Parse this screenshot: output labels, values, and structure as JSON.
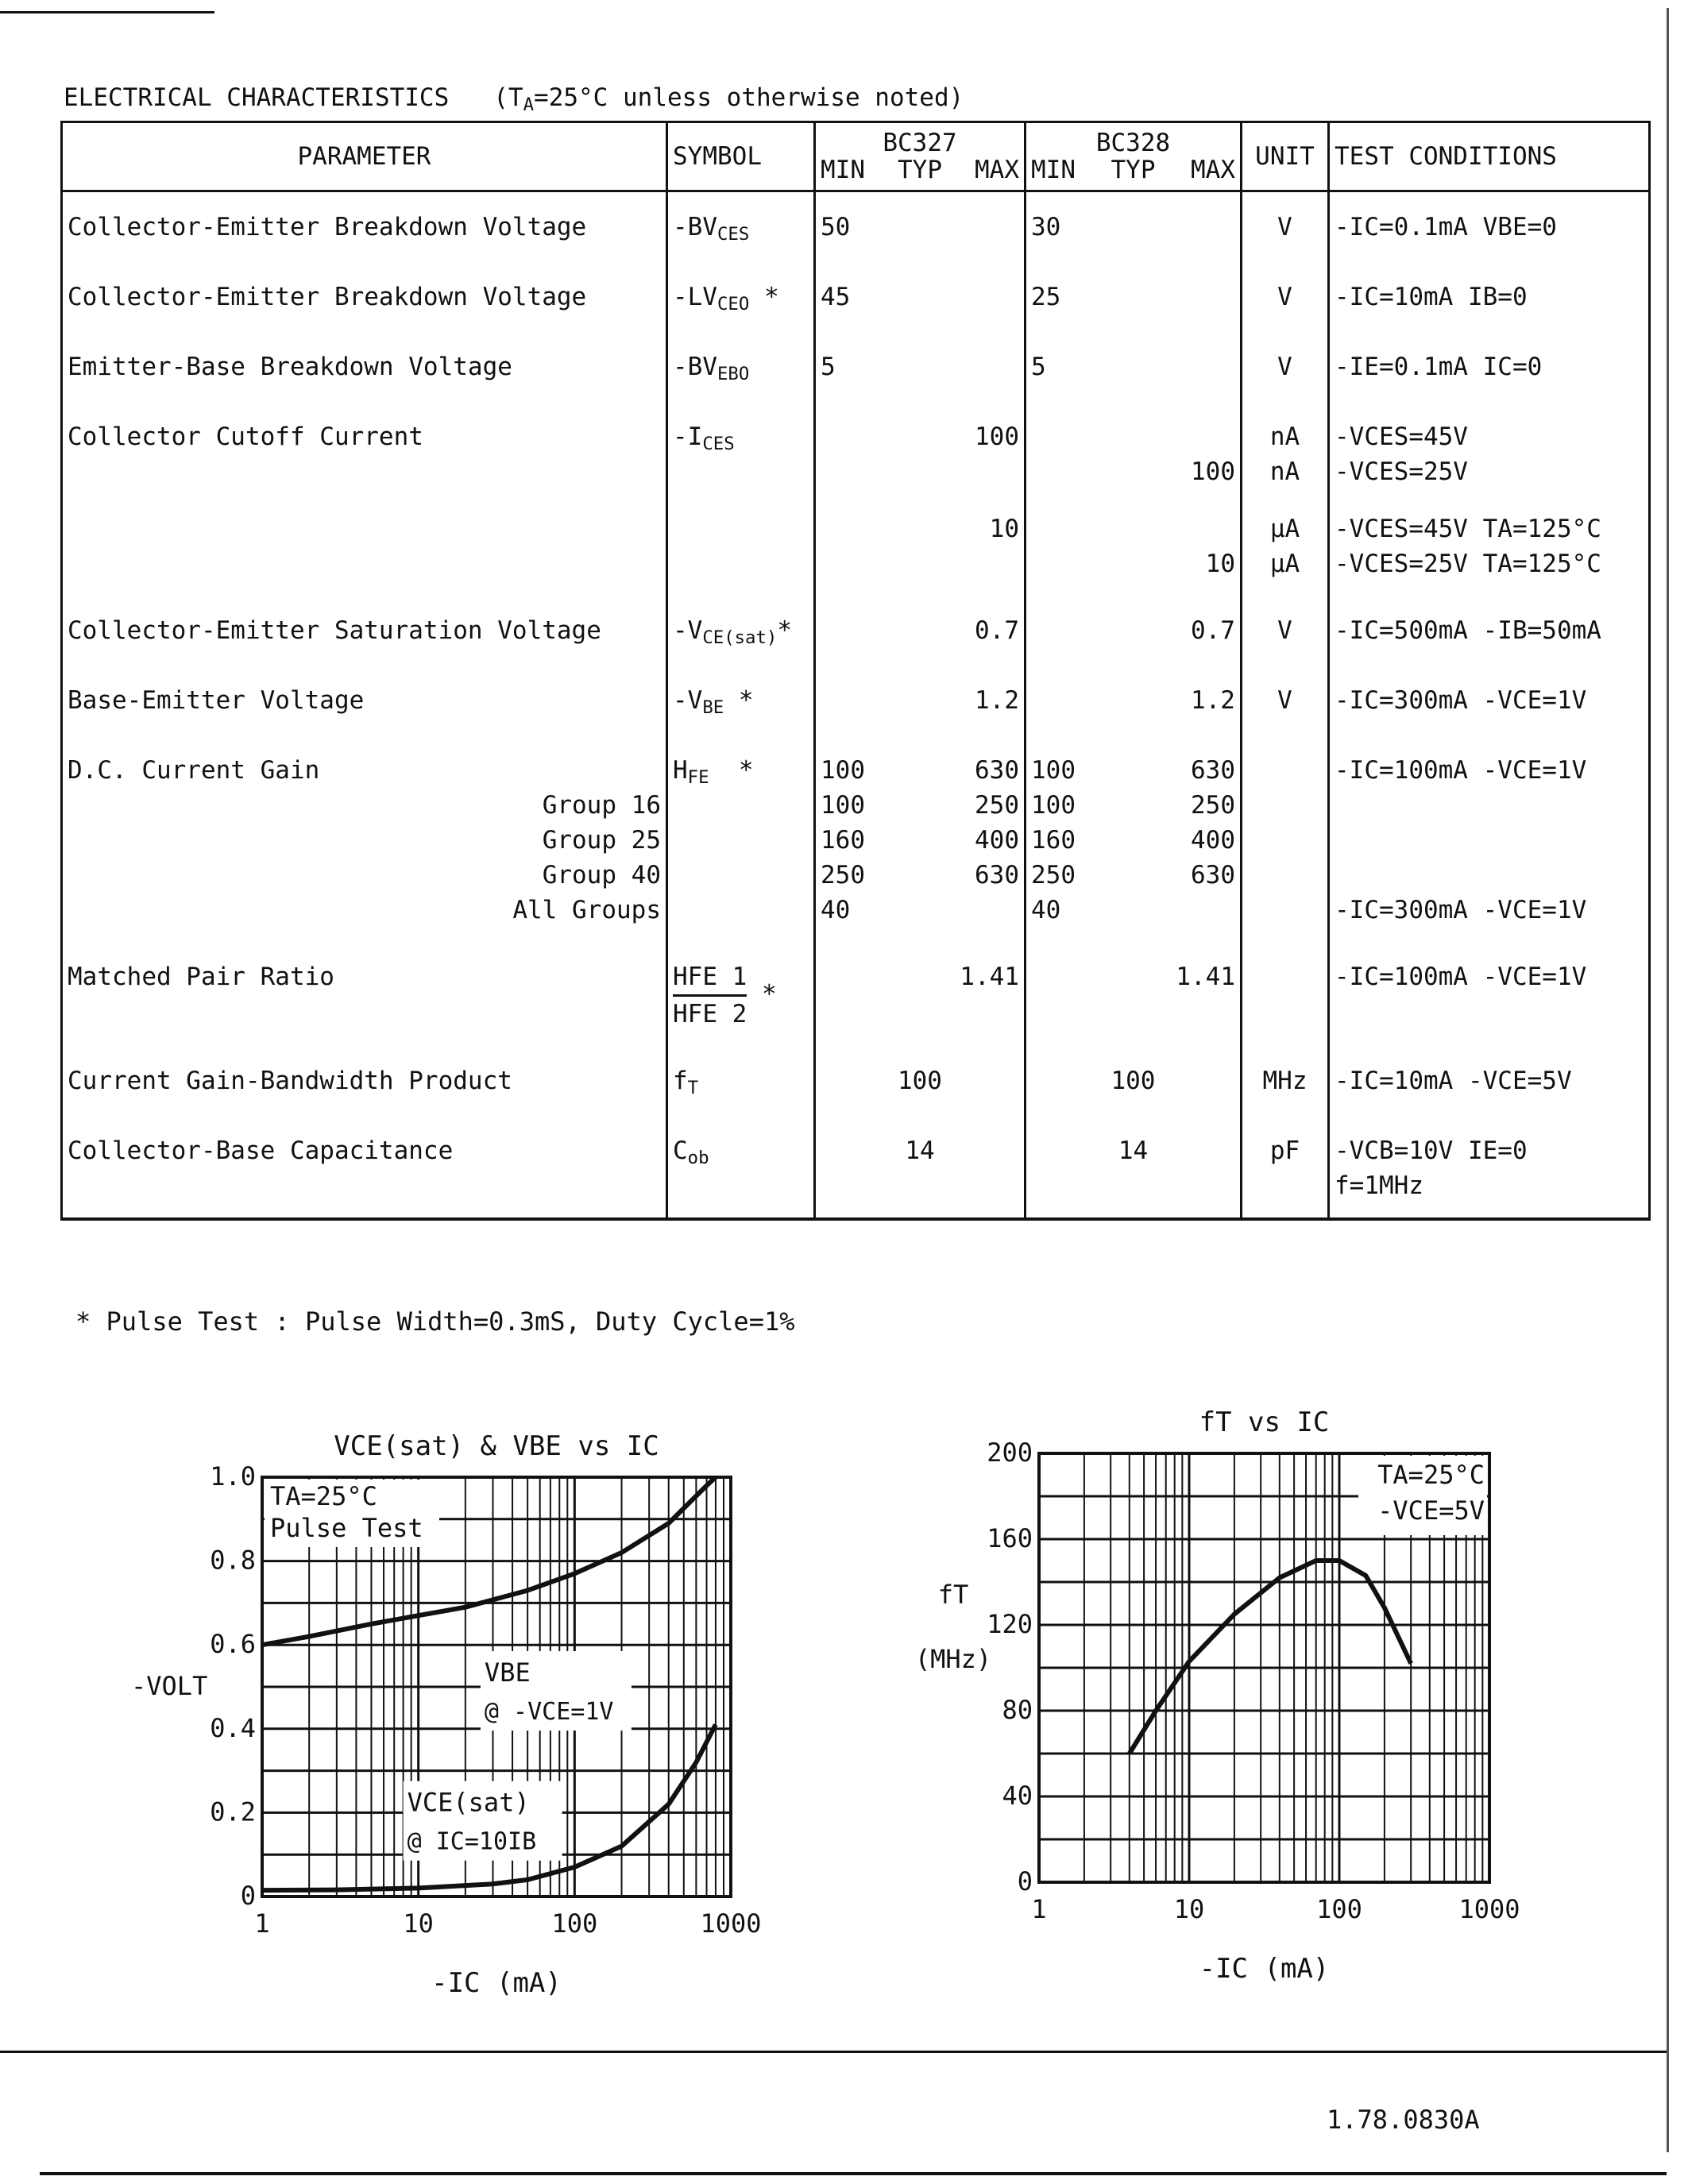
{
  "header": {
    "title": "ELECTRICAL CHARACTERISTICS",
    "condition_prefix": "(T",
    "condition_sub": "A",
    "condition_suffix": "=25°C  unless otherwise noted)"
  },
  "table": {
    "columns": {
      "parameter": "PARAMETER",
      "symbol": "SYMBOL",
      "bc327": "BC327",
      "bc328": "BC328",
      "min_typ_max": [
        "MIN",
        "TYP",
        "MAX"
      ],
      "unit": "UNIT",
      "test_conditions": "TEST CONDITIONS"
    },
    "rows": [
      {
        "parameter": "Collector-Emitter Breakdown Voltage",
        "symbol": "-BV",
        "symbol_sub": "CES",
        "symbol_suffix": "",
        "bc327": {
          "min": "50",
          "typ": "",
          "max": ""
        },
        "bc328": {
          "min": "30",
          "typ": "",
          "max": ""
        },
        "unit": "V",
        "conditions": "-IC=0.1mA  VBE=0"
      },
      {
        "parameter": "Collector-Emitter Breakdown Voltage",
        "symbol": "-LV",
        "symbol_sub": "CEO",
        "symbol_suffix": " *",
        "bc327": {
          "min": "45",
          "typ": "",
          "max": ""
        },
        "bc328": {
          "min": "25",
          "typ": "",
          "max": ""
        },
        "unit": "V",
        "conditions": "-IC=10mA  IB=0"
      },
      {
        "parameter": "Emitter-Base Breakdown Voltage",
        "symbol": "-BV",
        "symbol_sub": "EBO",
        "symbol_suffix": "",
        "bc327": {
          "min": "5",
          "typ": "",
          "max": ""
        },
        "bc328": {
          "min": "5",
          "typ": "",
          "max": ""
        },
        "unit": "V",
        "conditions": "-IE=0.1mA  IC=0"
      },
      {
        "parameter": "Collector Cutoff Current",
        "symbol": "-I",
        "symbol_sub": "CES",
        "symbol_suffix": "",
        "lines": [
          {
            "bc327_max": "100",
            "bc328_max": "",
            "unit": "nA",
            "conditions": "-VCES=45V"
          },
          {
            "bc327_max": "",
            "bc328_max": "100",
            "unit": "nA",
            "conditions": "-VCES=25V"
          },
          {
            "bc327_max": "10",
            "bc328_max": "",
            "unit": "µA",
            "conditions": "-VCES=45V  TA=125°C"
          },
          {
            "bc327_max": "",
            "bc328_max": "10",
            "unit": "µA",
            "conditions": "-VCES=25V  TA=125°C"
          }
        ]
      },
      {
        "parameter": "Collector-Emitter Saturation Voltage",
        "symbol": "-V",
        "symbol_sub": "CE(sat)",
        "symbol_suffix": "*",
        "bc327": {
          "min": "",
          "typ": "",
          "max": "0.7"
        },
        "bc328": {
          "min": "",
          "typ": "",
          "max": "0.7"
        },
        "unit": "V",
        "conditions": "-IC=500mA  -IB=50mA"
      },
      {
        "parameter": "Base-Emitter Voltage",
        "symbol": "-V",
        "symbol_sub": "BE",
        "symbol_suffix": " *",
        "bc327": {
          "min": "",
          "typ": "",
          "max": "1.2"
        },
        "bc328": {
          "min": "",
          "typ": "",
          "max": "1.2"
        },
        "unit": "V",
        "conditions": "-IC=300mA  -VCE=1V"
      },
      {
        "parameter": "D.C. Current Gain",
        "symbol": "H",
        "symbol_sub": "FE",
        "symbol_suffix": "  *",
        "groups": [
          {
            "label": "",
            "bc327_min": "100",
            "bc327_max": "630",
            "bc328_min": "100",
            "bc328_max": "630",
            "conditions": "-IC=100mA  -VCE=1V"
          },
          {
            "label": "Group 16",
            "bc327_min": "100",
            "bc327_max": "250",
            "bc328_min": "100",
            "bc328_max": "250",
            "conditions": ""
          },
          {
            "label": "Group 25",
            "bc327_min": "160",
            "bc327_max": "400",
            "bc328_min": "160",
            "bc328_max": "400",
            "conditions": ""
          },
          {
            "label": "Group 40",
            "bc327_min": "250",
            "bc327_max": "630",
            "bc328_min": "250",
            "bc328_max": "630",
            "conditions": ""
          },
          {
            "label": "All Groups",
            "bc327_min": "40",
            "bc327_max": "",
            "bc328_min": "40",
            "bc328_max": "",
            "conditions": "-IC=300mA  -VCE=1V"
          }
        ]
      },
      {
        "parameter": "Matched Pair Ratio",
        "parameter_prefix": "HFE",
        "symbol_num": "HFE 1",
        "symbol_den": "HFE 2",
        "symbol_suffix": "*",
        "bc327": {
          "min": "",
          "typ": "",
          "max": "1.41"
        },
        "bc328": {
          "min": "",
          "typ": "",
          "max": "1.41"
        },
        "unit": "",
        "conditions": "-IC=100mA  -VCE=1V"
      },
      {
        "parameter": "Current Gain-Bandwidth Product",
        "symbol": "f",
        "symbol_sub": "T",
        "symbol_suffix": "",
        "bc327": {
          "min": "",
          "typ": "100",
          "max": ""
        },
        "bc328": {
          "min": "",
          "typ": "100",
          "max": ""
        },
        "unit": "MHz",
        "conditions": "-IC=10mA  -VCE=5V"
      },
      {
        "parameter": "Collector-Base Capacitance",
        "symbol": "C",
        "symbol_sub": "ob",
        "symbol_suffix": "",
        "bc327": {
          "min": "",
          "typ": "14",
          "max": ""
        },
        "bc328": {
          "min": "",
          "typ": "14",
          "max": ""
        },
        "unit": "pF",
        "conditions": "-VCB=10V   IE=0",
        "conditions2": "f=1MHz"
      }
    ]
  },
  "footnote": "* Pulse Test : Pulse Width=0.3mS, Duty Cycle=1%",
  "document_id": "1.78.0830A",
  "chart_data": [
    {
      "type": "line",
      "title": "VCE(sat) & VBE  vs  IC",
      "xlabel": "-IC (mA)",
      "ylabel": "-VOLT",
      "xscale": "log",
      "xlim": [
        1,
        1000
      ],
      "ylim": [
        0,
        1.0
      ],
      "xticks": [
        "1",
        "10",
        "100",
        "1000"
      ],
      "yticks": [
        "0",
        "0.2",
        "0.4",
        "0.6",
        "0.8",
        "1.0"
      ],
      "grid": true,
      "annotation_box": [
        "TA=25°C",
        "Pulse Test"
      ],
      "annotation_position": "top-left",
      "series": [
        {
          "name": "VBE @ -VCE=1V",
          "label_lines": [
            "VBE",
            "@ -VCE=1V"
          ],
          "x": [
            1,
            2,
            5,
            10,
            20,
            50,
            100,
            200,
            400,
            700,
            800
          ],
          "y": [
            0.6,
            0.62,
            0.65,
            0.67,
            0.69,
            0.73,
            0.77,
            0.82,
            0.89,
            0.98,
            1.0
          ]
        },
        {
          "name": "VCE(sat) @ IC=10IB",
          "label_lines": [
            "VCE(sat)",
            "@ IC=10IB"
          ],
          "x": [
            1,
            3,
            10,
            30,
            50,
            100,
            200,
            400,
            600,
            800
          ],
          "y": [
            0.015,
            0.016,
            0.02,
            0.03,
            0.04,
            0.07,
            0.12,
            0.22,
            0.32,
            0.41
          ]
        }
      ]
    },
    {
      "type": "line",
      "title": "fT  vs  IC",
      "xlabel": "-IC (mA)",
      "ylabel": "fT (MHz)",
      "ylabel_lines": [
        "fT",
        "(MHz)"
      ],
      "xscale": "log",
      "xlim": [
        1,
        1000
      ],
      "ylim": [
        0,
        200
      ],
      "xticks": [
        "1",
        "10",
        "100",
        "1000"
      ],
      "yticks": [
        "0",
        "40",
        "80",
        "120",
        "160",
        "200"
      ],
      "grid": true,
      "annotation_box": [
        "TA=25°C",
        "-VCE=5V"
      ],
      "annotation_position": "top-right",
      "series": [
        {
          "name": "fT",
          "x": [
            4,
            6,
            10,
            20,
            40,
            70,
            100,
            150,
            200,
            300
          ],
          "y": [
            60,
            80,
            103,
            125,
            142,
            150,
            150,
            143,
            128,
            102
          ]
        }
      ]
    }
  ]
}
